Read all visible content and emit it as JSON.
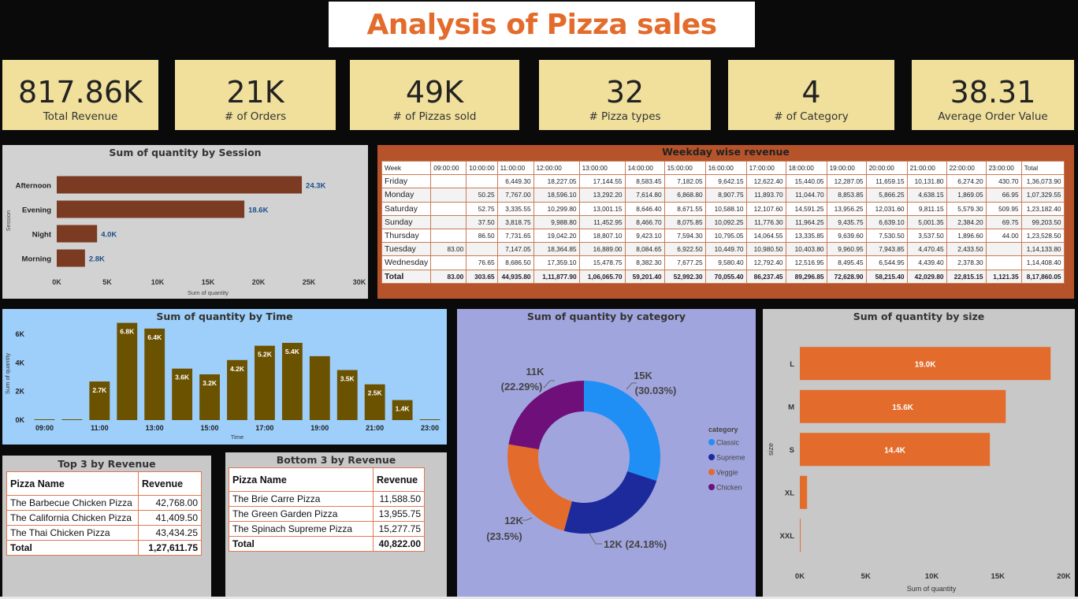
{
  "title": "Analysis of Pizza sales",
  "kpis": [
    {
      "value": "817.86K",
      "label": "Total Revenue"
    },
    {
      "value": "21K",
      "label": "# of Orders"
    },
    {
      "value": "49K",
      "label": "# of Pizzas sold"
    },
    {
      "value": "32",
      "label": "# Pizza types"
    },
    {
      "value": "4",
      "label": "# of Category"
    },
    {
      "value": "38.31",
      "label": "Average Order Value"
    }
  ],
  "colors": {
    "title": "#e36c2c",
    "kpi_bg": "#f0e09c",
    "session_bar": "#7a3b22",
    "time_bar": "#6b5200",
    "size_bar": "#e36c2c",
    "classic": "#1f8ff5",
    "supreme": "#1c2a9c",
    "veggie": "#e36c2c",
    "chicken": "#6e0f7a"
  },
  "chart_data": [
    {
      "type": "bar",
      "orientation": "horizontal",
      "title": "Sum of quantity by Session",
      "xlabel": "Sum of quantity",
      "ylabel": "Session",
      "categories": [
        "Afternoon",
        "Evening",
        "Night",
        "Morning"
      ],
      "values": [
        24300,
        18600,
        4000,
        2800
      ],
      "data_labels": [
        "24.3K",
        "18.6K",
        "4.0K",
        "2.8K"
      ],
      "xlim": [
        0,
        30000
      ],
      "x_ticks": [
        "0K",
        "5K",
        "10K",
        "15K",
        "20K",
        "25K",
        "30K"
      ]
    },
    {
      "type": "table",
      "title": "Weekday wise revenue",
      "columns": [
        "Week",
        "09:00:00",
        "10:00:00",
        "11:00:00",
        "12:00:00",
        "13:00:00",
        "14:00:00",
        "15:00:00",
        "16:00:00",
        "17:00:00",
        "18:00:00",
        "19:00:00",
        "20:00:00",
        "21:00:00",
        "22:00:00",
        "23:00:00",
        "Total"
      ],
      "rows": [
        [
          "Friday",
          "",
          "",
          "6,449.30",
          "18,227.05",
          "17,144.55",
          "8,583.45",
          "7,182.05",
          "9,642.15",
          "12,622.40",
          "15,440.05",
          "12,287.05",
          "11,659.15",
          "10,131.80",
          "6,274.20",
          "430.70",
          "1,36,073.90"
        ],
        [
          "Monday",
          "",
          "50.25",
          "7,767.00",
          "18,596.10",
          "13,292.20",
          "7,614.80",
          "6,868.80",
          "8,907.75",
          "11,893.70",
          "11,044.70",
          "8,853.85",
          "5,866.25",
          "4,638.15",
          "1,869.05",
          "66.95",
          "1,07,329.55"
        ],
        [
          "Saturday",
          "",
          "52.75",
          "3,335.55",
          "10,299.80",
          "13,001.15",
          "8,646.40",
          "8,671.55",
          "10,588.10",
          "12,107.60",
          "14,591.25",
          "13,956.25",
          "12,031.60",
          "9,811.15",
          "5,579.30",
          "509.95",
          "1,23,182.40"
        ],
        [
          "Sunday",
          "",
          "37.50",
          "3,818.75",
          "9,988.80",
          "11,452.95",
          "8,466.70",
          "8,075.85",
          "10,092.25",
          "11,776.30",
          "11,964.25",
          "9,435.75",
          "6,639.10",
          "5,001.35",
          "2,384.20",
          "69.75",
          "99,203.50"
        ],
        [
          "Thursday",
          "",
          "86.50",
          "7,731.65",
          "19,042.20",
          "18,807.10",
          "9,423.10",
          "7,594.30",
          "10,795.05",
          "14,064.55",
          "13,335.85",
          "9,639.60",
          "7,530.50",
          "3,537.50",
          "1,896.60",
          "44.00",
          "1,23,528.50"
        ],
        [
          "Tuesday",
          "83.00",
          "",
          "7,147.05",
          "18,364.85",
          "16,889.00",
          "8,084.65",
          "6,922.50",
          "10,449.70",
          "10,980.50",
          "10,403.80",
          "9,960.95",
          "7,943.85",
          "4,470.45",
          "2,433.50",
          "",
          "1,14,133.80"
        ],
        [
          "Wednesday",
          "",
          "76.65",
          "8,686.50",
          "17,359.10",
          "15,478.75",
          "8,382.30",
          "7,677.25",
          "9,580.40",
          "12,792.40",
          "12,516.95",
          "8,495.45",
          "6,544.95",
          "4,439.40",
          "2,378.30",
          "",
          "1,14,408.40"
        ]
      ],
      "total_row": [
        "Total",
        "83.00",
        "303.65",
        "44,935.80",
        "1,11,877.90",
        "1,06,065.70",
        "59,201.40",
        "52,992.30",
        "70,055.40",
        "86,237.45",
        "89,296.85",
        "72,628.90",
        "58,215.40",
        "42,029.80",
        "22,815.15",
        "1,121.35",
        "8,17,860.05"
      ]
    },
    {
      "type": "bar",
      "title": "Sum of quantity by Time",
      "xlabel": "Time",
      "ylabel": "Sum of quantity",
      "categories": [
        "09:00",
        "10:00",
        "11:00",
        "12:00",
        "13:00",
        "14:00",
        "15:00",
        "16:00",
        "17:00",
        "18:00",
        "19:00",
        "20:00",
        "21:00",
        "22:00",
        "23:00"
      ],
      "values": [
        4,
        18,
        2700,
        6800,
        6400,
        3600,
        3200,
        4200,
        5200,
        5400,
        4470,
        3500,
        2500,
        1400,
        28
      ],
      "data_labels": [
        "",
        "",
        "2.7K",
        "6.8K",
        "6.4K",
        "3.6K",
        "3.2K",
        "4.2K",
        "5.2K",
        "5.4K",
        "",
        "3.5K",
        "2.5K",
        "1.4K",
        ""
      ],
      "x_ticks": [
        "09:00",
        "11:00",
        "13:00",
        "15:00",
        "17:00",
        "19:00",
        "21:00",
        "23:00"
      ],
      "y_ticks": [
        "0K",
        "2K",
        "4K",
        "6K"
      ],
      "ylim": [
        0,
        7000
      ]
    },
    {
      "type": "pie",
      "donut": true,
      "title": "Sum of quantity by category",
      "legend_title": "category",
      "legend_placement": "right",
      "categories": [
        "Classic",
        "Supreme",
        "Veggie",
        "Chicken"
      ],
      "values": [
        30.03,
        24.18,
        23.5,
        22.29
      ],
      "labels": [
        {
          "value": "15K",
          "pct": "(30.03%)"
        },
        {
          "value": "12K (24.18%)",
          "pct": ""
        },
        {
          "value": "12K",
          "pct": "(23.5%)"
        },
        {
          "value": "11K",
          "pct": "(22.29%)"
        }
      ]
    },
    {
      "type": "bar",
      "orientation": "horizontal",
      "title": "Sum of quantity by size",
      "xlabel": "Sum of quantity",
      "ylabel": "size",
      "categories": [
        "L",
        "M",
        "S",
        "XL",
        "XXL"
      ],
      "values": [
        19000,
        15600,
        14400,
        550,
        28
      ],
      "data_labels": [
        "19.0K",
        "15.6K",
        "14.4K",
        "",
        ""
      ],
      "xlim": [
        0,
        20000
      ],
      "x_ticks": [
        "0K",
        "5K",
        "10K",
        "15K",
        "20K"
      ]
    }
  ],
  "top3": {
    "title": "Top 3 by Revenue",
    "col_name": "Pizza Name",
    "col_rev": "Revenue",
    "rows": [
      {
        "name": "The Barbecue Chicken Pizza",
        "rev": "42,768.00"
      },
      {
        "name": "The California Chicken Pizza",
        "rev": "41,409.50"
      },
      {
        "name": "The Thai Chicken Pizza",
        "rev": "43,434.25"
      }
    ],
    "total_label": "Total",
    "total": "1,27,611.75"
  },
  "bottom3": {
    "title": "Bottom 3 by Revenue",
    "col_name": "Pizza Name",
    "col_rev": "Revenue",
    "rows": [
      {
        "name": "The Brie Carre Pizza",
        "rev": "11,588.50"
      },
      {
        "name": "The Green Garden Pizza",
        "rev": "13,955.75"
      },
      {
        "name": "The Spinach Supreme Pizza",
        "rev": "15,277.75"
      }
    ],
    "total_label": "Total",
    "total": "40,822.00"
  }
}
